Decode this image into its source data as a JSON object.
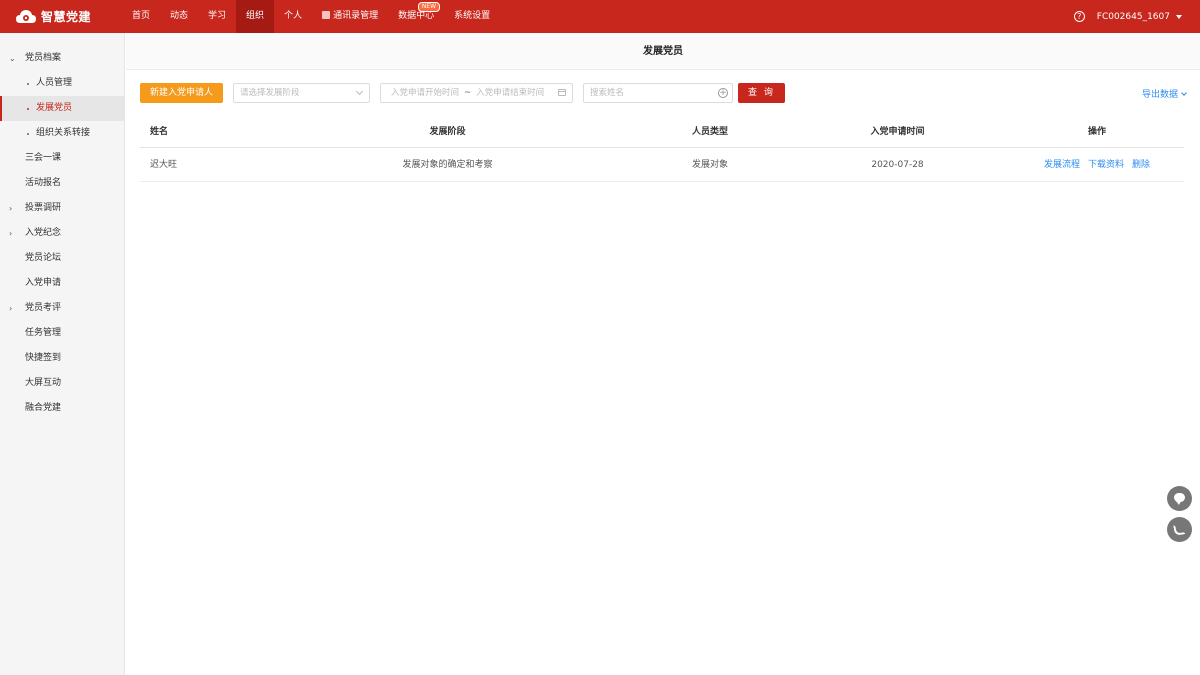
{
  "brand": {
    "name": "智慧党建"
  },
  "nav": {
    "items": [
      {
        "label": "首页",
        "active": false
      },
      {
        "label": "动态",
        "active": false
      },
      {
        "label": "学习",
        "active": false
      },
      {
        "label": "组织",
        "active": true
      },
      {
        "label": "个人",
        "active": false
      },
      {
        "label": "通讯录管理",
        "active": false,
        "icon": "contacts-icon"
      },
      {
        "label": "数据中心",
        "active": false,
        "badge": "NEW"
      },
      {
        "label": "系统设置",
        "active": false
      }
    ]
  },
  "header_right": {
    "help": "?",
    "user": "FC002645_1607"
  },
  "sidebar": {
    "items": [
      {
        "label": "党员档案",
        "expander": "⌄",
        "level": 0
      },
      {
        "label": "人员管理",
        "level": 1
      },
      {
        "label": "发展党员",
        "level": 1,
        "active": true
      },
      {
        "label": "组织关系转接",
        "level": 1
      },
      {
        "label": "三会一课",
        "level": 0
      },
      {
        "label": "活动报名",
        "level": 0
      },
      {
        "label": "投票调研",
        "expander": "›",
        "level": 0
      },
      {
        "label": "入党纪念",
        "expander": "›",
        "level": 0
      },
      {
        "label": "党员论坛",
        "level": 0
      },
      {
        "label": "入党申请",
        "level": 0
      },
      {
        "label": "党员考评",
        "expander": "›",
        "level": 0
      },
      {
        "label": "任务管理",
        "level": 0
      },
      {
        "label": "快捷签到",
        "level": 0
      },
      {
        "label": "大屏互动",
        "level": 0
      },
      {
        "label": "融合党建",
        "level": 0
      }
    ]
  },
  "page": {
    "title": "发展党员"
  },
  "toolbar": {
    "new_button": "新建入党申请人",
    "stage_placeholder": "请选择发展阶段",
    "date_start_placeholder": "入党申请开始时间",
    "date_sep": "~",
    "date_end_placeholder": "入党申请结束时间",
    "name_placeholder": "搜索姓名",
    "query_button": "查 询",
    "export": "导出数据"
  },
  "table": {
    "headers": [
      "姓名",
      "发展阶段",
      "人员类型",
      "入党申请时间",
      "操作"
    ],
    "rows": [
      {
        "name": "迟大旺",
        "stage": "发展对象的确定和考察",
        "type": "发展对象",
        "date": "2020-07-28",
        "actions": [
          "发展流程",
          "下载资料",
          "删除"
        ]
      }
    ]
  },
  "colors": {
    "brand_red": "#c8271d",
    "orange": "#f59a1b",
    "link_blue": "#2d8cf0"
  }
}
